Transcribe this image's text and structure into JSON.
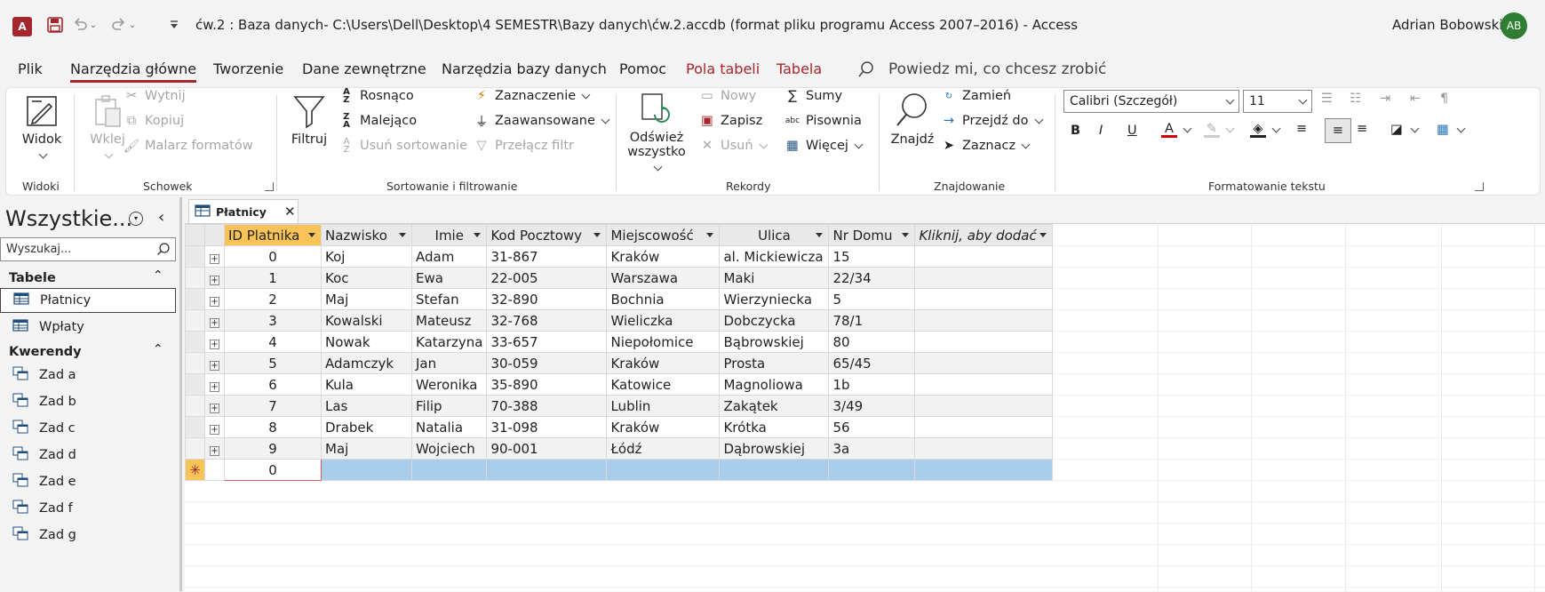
{
  "titlebar": {
    "app_icon": "A",
    "title": "ćw.2 : Baza danych- C:\\Users\\Dell\\Desktop\\4 SEMESTR\\Bazy danych\\ćw.2.accdb (format pliku programu Access 2007–2016)  -  Access",
    "user_name": "Adrian Bobowski",
    "user_initials": "AB"
  },
  "tabs": [
    "Plik",
    "Narzędzia główne",
    "Tworzenie",
    "Dane zewnętrzne",
    "Narzędzia bazy danych",
    "Pomoc",
    "Pola tabeli",
    "Tabela"
  ],
  "tell_me": "Powiedz mi, co chcesz zrobić",
  "ribbon": {
    "widoki": {
      "label": "Widoki",
      "widok": "Widok"
    },
    "schowek": {
      "label": "Schowek",
      "wklej": "Wklej",
      "wytnij": "Wytnij",
      "kopiuj": "Kopiuj",
      "malarz": "Malarz formatów"
    },
    "sortowanie": {
      "label": "Sortowanie i filtrowanie",
      "filtruj": "Filtruj",
      "rosnaco": "Rosnąco",
      "malejaco": "Malejąco",
      "usun_sort": "Usuń sortowanie",
      "zaznaczenie": "Zaznaczenie",
      "zaawansowane": "Zaawansowane",
      "przelacz": "Przełącz filtr"
    },
    "rekordy": {
      "label": "Rekordy",
      "odswiez_1": "Odśwież",
      "odswiez_2": "wszystko",
      "nowy": "Nowy",
      "zapisz": "Zapisz",
      "usun": "Usuń",
      "sumy": "Sumy",
      "pisownia": "Pisownia",
      "wiecej": "Więcej",
      "abc": "abc"
    },
    "znajdowanie": {
      "label": "Znajdowanie",
      "znajdz": "Znajdź",
      "zamien": "Zamień",
      "przejdz": "Przejdź do",
      "zaznacz": "Zaznacz"
    },
    "formatowanie": {
      "label": "Formatowanie tekstu",
      "font": "Calibri (Szczegół)",
      "size": "11",
      "bold": "B",
      "italic": "I",
      "underline": "U"
    }
  },
  "nav": {
    "title": "Wszystkie...",
    "search_placeholder": "Wyszukaj...",
    "tables_header": "Tabele",
    "tables": [
      "Płatnicy",
      "Wpłaty"
    ],
    "queries_header": "Kwerendy",
    "queries": [
      "Zad a",
      "Zad b",
      "Zad c",
      "Zad d",
      "Zad e",
      "Zad f",
      "Zad g"
    ]
  },
  "doc_tab": "Płatnicy",
  "table": {
    "columns": [
      "ID Platnika",
      "Nazwisko",
      "Imie",
      "Kod Pocztowy",
      "Miejscowość",
      "Ulica",
      "Nr Domu",
      "Kliknij, aby dodać"
    ],
    "rows": [
      [
        "0",
        "Koj",
        "Adam",
        "31-867",
        "Kraków",
        "al. Mickiewicza",
        "15"
      ],
      [
        "1",
        "Koc",
        "Ewa",
        "22-005",
        "Warszawa",
        "Maki",
        "22/34"
      ],
      [
        "2",
        "Maj",
        "Stefan",
        "32-890",
        "Bochnia",
        "Wierzyniecka",
        "5"
      ],
      [
        "3",
        "Kowalski",
        "Mateusz",
        "32-768",
        "Wieliczka",
        "Dobczycka",
        "78/1"
      ],
      [
        "4",
        "Nowak",
        "Katarzyna",
        "33-657",
        "Niepołomice",
        "Bąbrowskiej",
        "80"
      ],
      [
        "5",
        "Adamczyk",
        "Jan",
        "30-059",
        "Kraków",
        "Prosta",
        "65/45"
      ],
      [
        "6",
        "Kula",
        "Weronika",
        "35-890",
        "Katowice",
        "Magnoliowa",
        "1b"
      ],
      [
        "7",
        "Las",
        "Filip",
        "70-388",
        "Lublin",
        "Zakątek",
        "3/49"
      ],
      [
        "8",
        "Drabek",
        "Natalia",
        "31-098",
        "Kraków",
        "Krótka",
        "56"
      ],
      [
        "9",
        "Maj",
        "Wojciech",
        "90-001",
        "Łódź",
        "Dąbrowskiej",
        "3a"
      ]
    ],
    "new_row_id": "0",
    "new_row_marker": "✳"
  },
  "colors": {
    "accent": "#a4262c",
    "header_selected": "#f8c45a",
    "new_row": "#a9cdea",
    "avatar": "#2e7d32"
  }
}
